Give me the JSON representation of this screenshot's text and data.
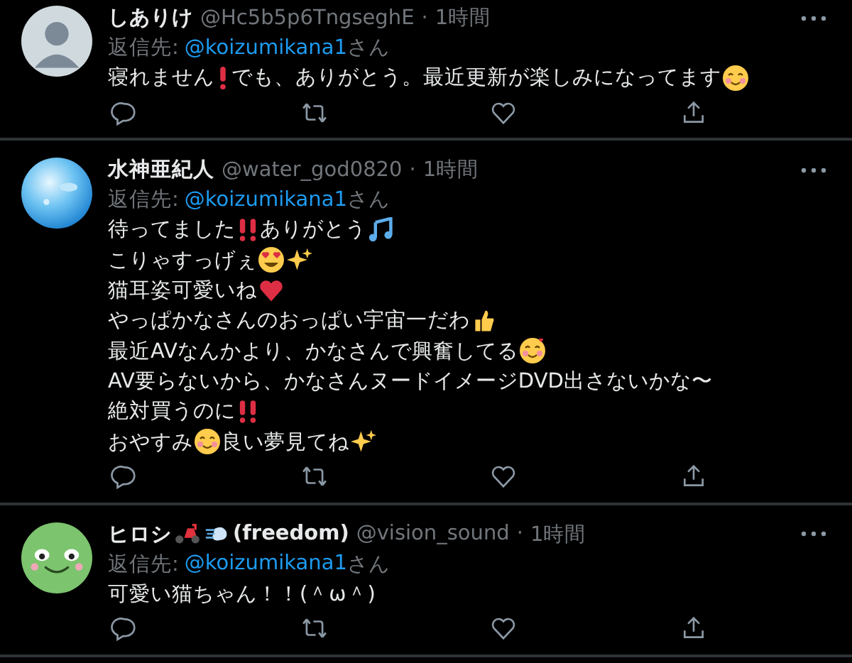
{
  "tweets": [
    {
      "name": [
        {
          "t": "しありけ"
        }
      ],
      "handle": "@Hc5b5p6TngseghE",
      "separator": "·",
      "time": "1時間",
      "reply_label": "返信先:",
      "reply_to": "@koizumikana1",
      "reply_suffix": "さん",
      "lines": [
        [
          {
            "t": "寝れません"
          },
          {
            "kind": "emoji"
          },
          {
            "t": "でも、ありがとう。最近更新が楽しみになってます"
          },
          {
            "kind": "emoji"
          }
        ]
      ]
    },
    {
      "name": [
        {
          "t": "水神亜紀人"
        }
      ],
      "handle": "@water_god0820",
      "separator": "·",
      "time": "1時間",
      "reply_label": "返信先:",
      "reply_to": "@koizumikana1",
      "reply_suffix": "さん",
      "lines": [
        [
          {
            "t": "待ってました"
          },
          {
            "kind": "emoji"
          },
          {
            "t": "ありがとう"
          },
          {
            "kind": "emoji"
          }
        ],
        [
          {
            "t": "こりゃすっげぇ"
          },
          {
            "kind": "emoji"
          },
          {
            "kind": "emoji"
          }
        ],
        [
          {
            "t": "猫耳姿可愛いね"
          },
          {
            "kind": "emoji"
          }
        ],
        [
          {
            "t": "やっぱかなさんのおっぱい宇宙一だわ"
          },
          {
            "kind": "emoji"
          }
        ],
        [
          {
            "t": "最近AVなんかより、かなさんで興奮してる"
          },
          {
            "kind": "emoji"
          }
        ],
        [
          {
            "t": "AV要らないから、かなさんヌードイメージDVD出さないかな〜"
          }
        ],
        [
          {
            "t": "絶対買うのに"
          },
          {
            "kind": "emoji"
          }
        ],
        [
          {
            "t": "おやすみ"
          },
          {
            "kind": "emoji"
          },
          {
            "t": "良い夢見てね"
          },
          {
            "kind": "emoji"
          }
        ]
      ]
    },
    {
      "name": [
        {
          "t": "ヒロシ"
        },
        {
          "kind": "emoji"
        },
        {
          "kind": "emoji"
        },
        {
          "t": "(freedom)"
        }
      ],
      "handle": "@vision_sound",
      "separator": "·",
      "time": "1時間",
      "reply_label": "返信先:",
      "reply_to": "@koizumikana1",
      "reply_suffix": "さん",
      "lines": [
        [
          {
            "t": "可愛い猫ちゃん！！(＾ω＾)"
          }
        ]
      ]
    }
  ]
}
